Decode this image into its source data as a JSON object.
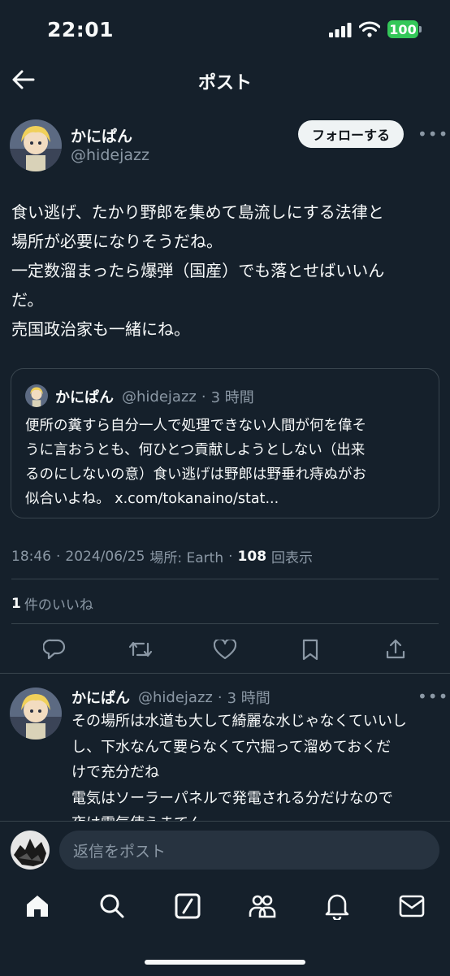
{
  "status_bar": {
    "time": "22:01",
    "battery": "100"
  },
  "header": {
    "title": "ポスト"
  },
  "post": {
    "display_name": "かにぱん",
    "handle": "@hidejazz",
    "follow_label": "フォローする",
    "more": "•••",
    "text_lines": [
      "食い逃げ、たかり野郎を集めて島流しにする法律と",
      "場所が必要になりそうだね。",
      "一定数溜まったら爆弾（国産）でも落とせばいいん",
      "だ。",
      "売国政治家も一緒にね。"
    ],
    "quote": {
      "display_name": "かにぱん",
      "handle": "@hidejazz",
      "dot": "·",
      "time": "3 時間",
      "lines": [
        "便所の糞すら自分一人で処理できない人間が何を偉そ",
        "うに言おうとも、何ひとつ貢献しようとしない（出来",
        "るのにしないの意）食い逃げは野郎は野垂れ痔ぬがお",
        "似合いよね。 x.com/tokanaino/stat..."
      ]
    },
    "meta": {
      "time": "18:46",
      "dot1": "·",
      "date": "2024/06/25",
      "location": "場所: Earth",
      "dot2": "·",
      "views": "108",
      "views_label": "回表示"
    },
    "likes": {
      "count": "1",
      "label": "件のいいね"
    }
  },
  "reply": {
    "display_name": "かにぱん",
    "handle": "@hidejazz",
    "dot": "·",
    "time": "3 時間",
    "more": "•••",
    "lines": [
      "その場所は水道も大して綺麗な水じゃなくていいし",
      "し、下水なんて要らなくて穴掘って溜めておくだ",
      "けで充分だね",
      "電気はソーラーパネルで発電される分だけなので",
      "夜は電気使えまてん。"
    ]
  },
  "compose": {
    "placeholder": "返信をポスト"
  },
  "icons": {
    "back": "arrow-left-icon",
    "reply": "reply-icon",
    "repost": "repost-icon",
    "like": "heart-icon",
    "bookmark": "bookmark-icon",
    "share": "share-icon",
    "nav": [
      "home-icon",
      "search-icon",
      "grok-icon",
      "communities-icon",
      "notifications-icon",
      "messages-icon"
    ]
  },
  "colors": {
    "background": "#15202b",
    "text": "#f7f9f9",
    "muted": "#8b98a5",
    "border": "#38444d",
    "battery": "#34c759"
  }
}
